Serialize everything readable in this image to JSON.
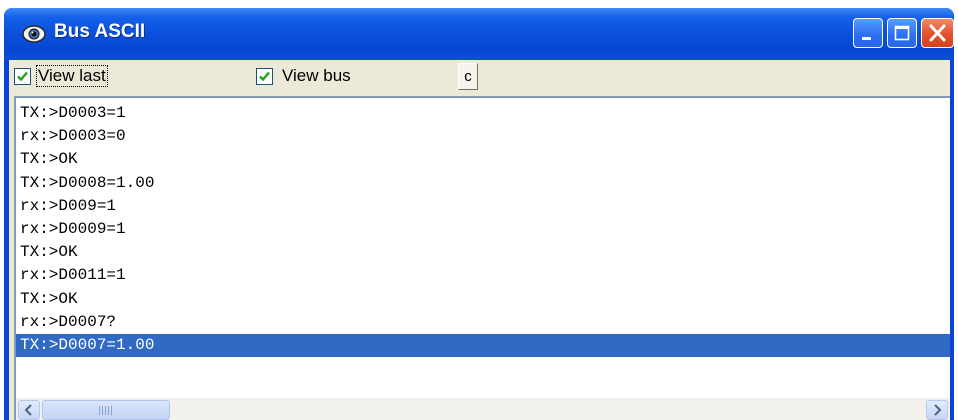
{
  "window": {
    "title": "Bus ASCII",
    "icon": "eye-icon",
    "controls": [
      "minimize-icon",
      "maximize-icon",
      "close-icon"
    ],
    "colors": {
      "titlebar": "#0a52de",
      "close": "#e2502b",
      "selection": "#316ac5"
    }
  },
  "toolbar": {
    "view_last": {
      "label": "View last",
      "checked": true
    },
    "view_bus": {
      "label": "View bus",
      "checked": true
    },
    "clear_label": "c"
  },
  "log": {
    "lines": [
      "TX:>D0003=1",
      "rx:>D0003=0",
      "TX:>OK",
      "TX:>D0008=1.00",
      "rx:>D009=1",
      "rx:>D0009=1",
      "TX:>OK",
      "rx:>D0011=1",
      "TX:>OK",
      "rx:>D0007?",
      "TX:>D0007=1.00"
    ],
    "selected_index": 10
  }
}
